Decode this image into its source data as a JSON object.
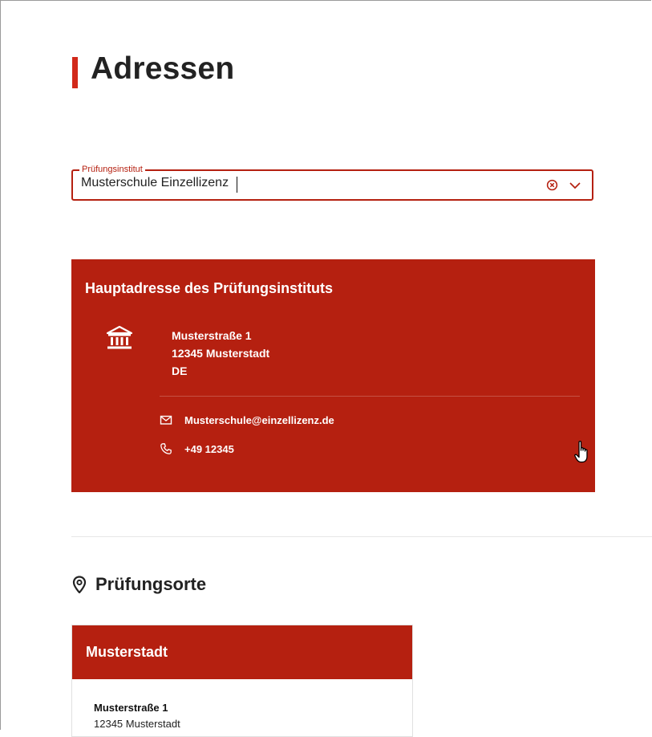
{
  "page": {
    "title": "Adressen"
  },
  "institute_field": {
    "legend": "Prüfungsinstitut",
    "value": "Musterschule Einzellizenz"
  },
  "main_address": {
    "title": "Hauptadresse des Prüfungsinstituts",
    "street": "Musterstraße 1",
    "city": "12345 Musterstadt",
    "country": "DE",
    "email": "Musterschule@einzellizenz.de",
    "phone": "+49 12345"
  },
  "locations": {
    "heading": "Prüfungsorte",
    "items": [
      {
        "name": "Musterstadt",
        "street": "Musterstraße 1",
        "city": "12345 Musterstadt"
      }
    ]
  },
  "icons": {
    "institution": "bank-icon",
    "email": "envelope-icon",
    "phone": "phone-icon",
    "location": "map-pin-icon",
    "clear": "clear-icon",
    "dropdown": "chevron-down-icon",
    "cursor": "hand-pointer-icon"
  },
  "colors": {
    "accent": "#b52010",
    "title_bar": "#d2291a"
  }
}
